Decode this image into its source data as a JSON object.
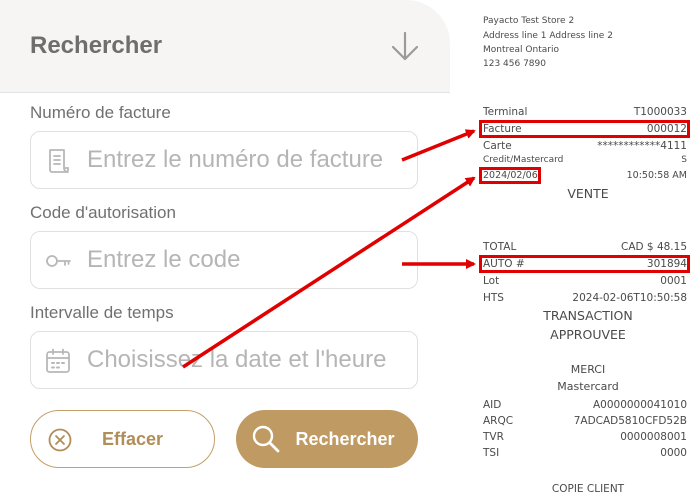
{
  "search_panel": {
    "title": "Rechercher",
    "invoice": {
      "label": "Numéro de facture",
      "placeholder": "Entrez le numéro de facture"
    },
    "auth": {
      "label": "Code d'autorisation",
      "placeholder": "Entrez le code"
    },
    "time": {
      "label": "Intervalle de temps",
      "placeholder": "Choisissez la date et l'heure"
    },
    "clear_label": "Effacer",
    "search_label": "Rechercher"
  },
  "receipt": {
    "store_lines": [
      "Payacto Test Store 2",
      "Address line 1 Address line 2",
      "Montreal Ontario",
      "123 456 7890"
    ],
    "terminal": {
      "label": "Terminal",
      "value": "T1000033"
    },
    "facture": {
      "label": "Facture",
      "value": "000012"
    },
    "carte": {
      "label": "Carte",
      "value": "************4111"
    },
    "card_type": {
      "label": "Credit/Mastercard",
      "value": "S"
    },
    "datetime": {
      "date": "2024/02/06",
      "time": "10:50:58 AM"
    },
    "transaction_type": "VENTE",
    "total": {
      "label": "TOTAL",
      "value": "CAD $ 48.15"
    },
    "auto": {
      "label": "AUTO #",
      "value": "301894"
    },
    "lot": {
      "label": "Lot",
      "value": "0001"
    },
    "hts": {
      "label": "HTS",
      "value": "2024-02-06T10:50:58"
    },
    "status_line1": "TRANSACTION",
    "status_line2": "APPROUVEE",
    "merci": "MERCI",
    "brand": "Mastercard",
    "aid": {
      "label": "AID",
      "value": "A0000000041010"
    },
    "arqc": {
      "label": "ARQC",
      "value": "7ADCAD5810CFD52B"
    },
    "tvr": {
      "label": "TVR",
      "value": "0000008001"
    },
    "tsi": {
      "label": "TSI",
      "value": "0000"
    },
    "copy": "COPIE CLIENT"
  },
  "colors": {
    "accent_gold": "#bf9a62",
    "highlight_red": "#e10000"
  }
}
